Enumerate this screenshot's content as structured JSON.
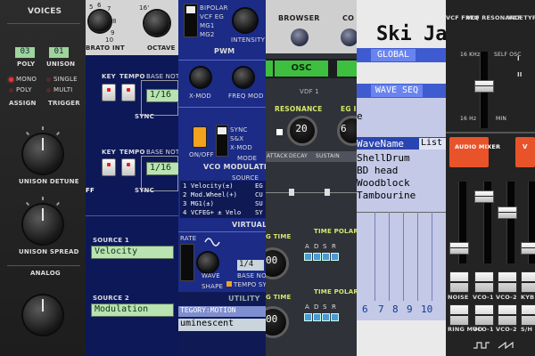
{
  "voices": {
    "title": "VOICES",
    "poly_value": "03",
    "poly_label": "POLY",
    "unison_value": "01",
    "unison_label": "UNISON",
    "assign_options": [
      "MONO",
      "POLY"
    ],
    "assign_label": "ASSIGN",
    "trigger_options": [
      "SINGLE",
      "MULTI"
    ],
    "trigger_label": "TRIGGER",
    "detune_label": "UNISON DETUNE",
    "spread_label": "UNISON SPREAD",
    "analog_label": "ANALOG"
  },
  "lfo_panel": {
    "vibrato_label": "BRATO INT",
    "octave_label": "OCTAVE",
    "scale_nums": [
      "5",
      "6",
      "7",
      "8",
      "9",
      "10",
      "16'",
      "0"
    ],
    "key_label": "KEY",
    "tempo_label": "TEMPO",
    "base_note_label": "BASE NOTE",
    "base_note_value": "1/16",
    "sync_label": "SYNC",
    "key_label_2": "KEY",
    "tempo_label_2": "TEMPO",
    "base_note_label_2": "BASE NOTE",
    "base_note_value_2": "1/16",
    "sync_label_2": "SYNC",
    "ff_label": "FF",
    "source1_label": "SOURCE 1",
    "source1_value": "Velocity",
    "source2_label": "SOURCE 2",
    "source2_value": "Modulation"
  },
  "vco_mod": {
    "pwm_options": [
      "BIPOLAR",
      "VCF EG",
      "MG1",
      "MG2"
    ],
    "intensity_label": "INTENSITY",
    "pwm_label": "PWM",
    "xmod_label": "X-MOD",
    "freqmod_label": "FREQ MOD",
    "onoff_label": "ON/OFF",
    "sync_options": [
      "SYNC",
      "S&X",
      "X-MOD"
    ],
    "mode_label": "MODE",
    "title": "VCO MODULATI",
    "source_header": "SOURCE",
    "sources": [
      {
        "n": "1",
        "text": "Velocity(±)",
        "tail": "EG"
      },
      {
        "n": "2",
        "text": "Mod.Wheel(+)",
        "tail": "CU"
      },
      {
        "n": "3",
        "text": "MG1(±)",
        "tail": "SU"
      },
      {
        "n": "4",
        "text": "VCFEG+ ± Velo",
        "tail": "SY"
      }
    ],
    "virtual_label": "VIRTUAL",
    "rate_label": "RATE",
    "wave_label": "WAVE",
    "shape_label": "SHAPE",
    "base_note_value": "1/4",
    "base_note_label": "BASE NOTE",
    "tempo_sync_label": "TEMPO SYN",
    "utility_label": "UTILITY",
    "category_text": "TEGORY:MOTION",
    "preset_text": "uminescent"
  },
  "browser_panel": {
    "browser_label": "BROWSER",
    "co_label": "CO",
    "osc_tab": "OSC",
    "vdf_label": "VDF 1",
    "resonance_label": "RESONANCE",
    "eg_label": "EG I",
    "resonance_value": "20",
    "eg_value": "6",
    "env_tabs": [
      "ATTACK",
      "DECAY",
      "SUSTAIN"
    ],
    "time_label": "G TIME",
    "time_polarity_label": "TIME POLARITY",
    "adsr": [
      "A",
      "D",
      "S",
      "R"
    ],
    "time_value": "00",
    "time_label_2": "G TIME",
    "time_polarity_label_2": "TIME POLARITY",
    "adsr_2": [
      "A",
      "D",
      "S",
      "R"
    ],
    "time_value_2": "00"
  },
  "wave_seq": {
    "title": "Ski Ja",
    "global_tab": "GLOBAL",
    "wave_seq_tab": "WAVE SEQ",
    "letter": "e",
    "header": "WaveName",
    "list_button": "List",
    "waves": [
      "ShellDrum",
      "BD head",
      "Woodblock",
      "Tambourine"
    ],
    "steps": [
      "6",
      "7",
      "8",
      "9",
      "10"
    ]
  },
  "mixer": {
    "vcf_freq_label": "VCF FREQ",
    "vcf_res_label": "VCF RESONANCE",
    "vcf_type_label": "VCF TYPE",
    "scale_16khz": "16 KHz",
    "scale_self_osc": "SELF OSC",
    "scale_16hz": "16 Hz",
    "scale_min": "MIN",
    "type_marks": [
      "I",
      "II"
    ],
    "audio_mixer_label": "AUDIO MIXER",
    "v_label": "V",
    "noise_label": "NOISE",
    "vco1_label": "VCO-1",
    "vco2_label": "VCO-2",
    "kyb_label": "KYB",
    "ring_mod_label": "RING MOD",
    "vco1_wave_label": "VCO-1",
    "vco2_wave_label": "VCO-2",
    "sh_label": "S/H",
    "accent_color": "#e8532a"
  }
}
